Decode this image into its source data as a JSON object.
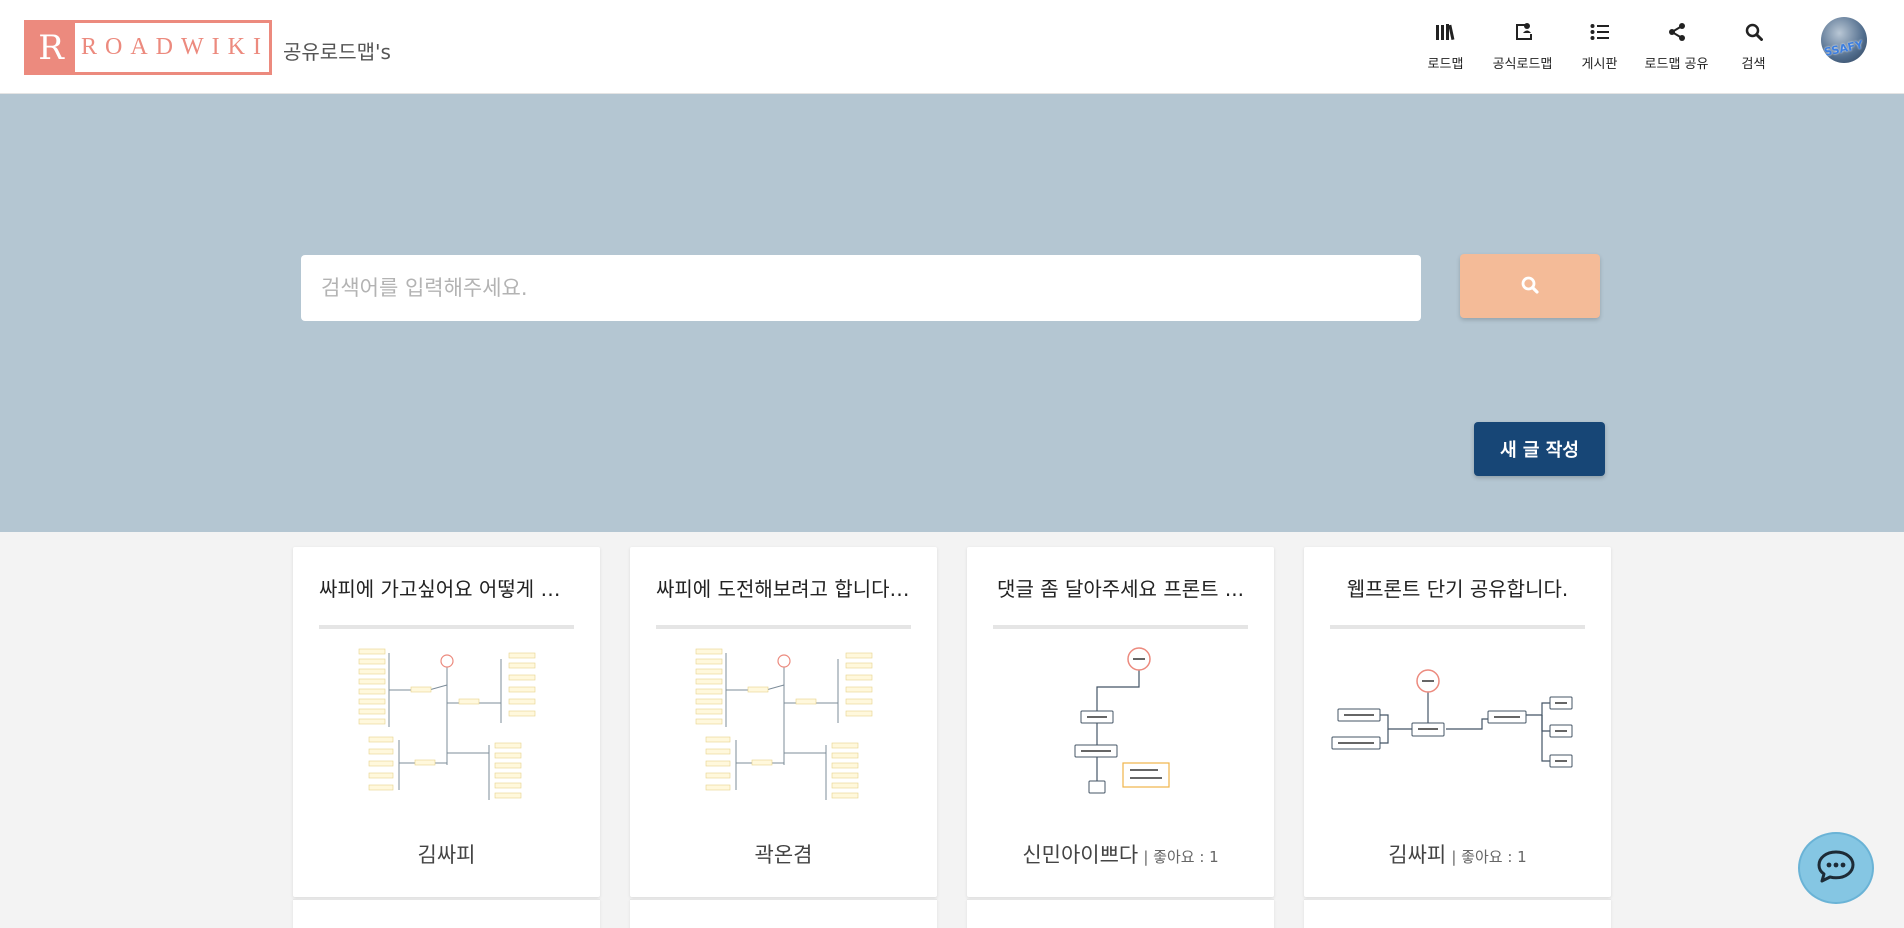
{
  "header": {
    "logo_mark": "R",
    "logo_text": "ROADWIKI",
    "subtitle": "공유로드맵's",
    "nav": [
      {
        "label": "로드맵",
        "icon": "books-icon"
      },
      {
        "label": "공식로드맵",
        "icon": "user-book-icon"
      },
      {
        "label": "게시판",
        "icon": "list-icon"
      },
      {
        "label": "로드맵 공유",
        "icon": "share-icon"
      },
      {
        "label": "검색",
        "icon": "search-icon"
      }
    ],
    "avatar_text": "SSAFY"
  },
  "hero": {
    "search_placeholder": "검색어를 입력해주세요.",
    "write_label": "새 글 작성"
  },
  "cards": [
    {
      "title": "싸피에 가고싶어요 어떻게 해야 할까요",
      "author": "김싸피",
      "likes": ""
    },
    {
      "title": "싸피에 도전해보려고 합니다!...",
      "author": "곽온겸",
      "likes": ""
    },
    {
      "title": "댓글 좀 달아주세요 프론트 ...",
      "author": "신민아이쁘다",
      "likes": "| 좋아요 : 1"
    },
    {
      "title": "웹프론트 단기 공유합니다.",
      "author": "김싸피",
      "likes": "| 좋아요 : 1"
    }
  ],
  "colors": {
    "brand": "#ec8a7e",
    "hero_bg": "#b4c6d2",
    "search_button": "#f4bb98",
    "write_button": "#174676",
    "chat_button": "#85c6e3"
  }
}
